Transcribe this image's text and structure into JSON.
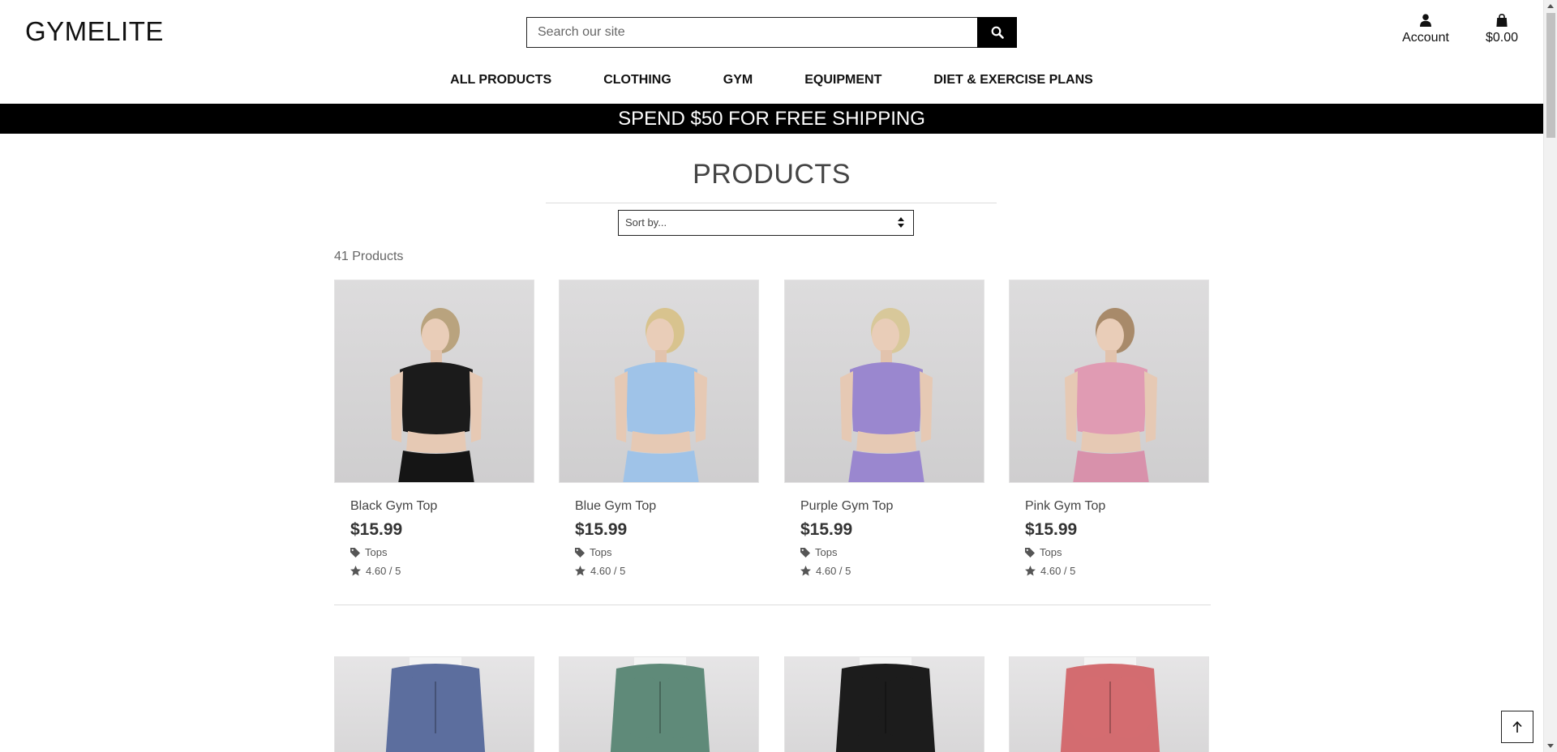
{
  "header": {
    "logo": "GYMELITE",
    "search_placeholder": "Search our site",
    "account_label": "Account",
    "cart_total": "$0.00"
  },
  "nav": {
    "items": [
      "ALL PRODUCTS",
      "CLOTHING",
      "GYM",
      "EQUIPMENT",
      "DIET & EXERCISE PLANS"
    ]
  },
  "banner": "SPEND $50 FOR FREE SHIPPING",
  "main": {
    "title": "PRODUCTS",
    "sort_label": "Sort by...",
    "count": "41 Products"
  },
  "products": [
    {
      "name": "Black Gym Top",
      "price": "$15.99",
      "category": "Tops",
      "rating": "4.60 / 5",
      "colors": {
        "top": "#1b1b1b",
        "bottom": "#151515",
        "hair": "#b9a37e"
      }
    },
    {
      "name": "Blue Gym Top",
      "price": "$15.99",
      "category": "Tops",
      "rating": "4.60 / 5",
      "colors": {
        "top": "#9fc3e8",
        "bottom": "#9fc3e8",
        "hair": "#d8c38e"
      }
    },
    {
      "name": "Purple Gym Top",
      "price": "$15.99",
      "category": "Tops",
      "rating": "4.60 / 5",
      "colors": {
        "top": "#9a87cf",
        "bottom": "#9a87cf",
        "hair": "#d8c89a"
      }
    },
    {
      "name": "Pink Gym Top",
      "price": "$15.99",
      "category": "Tops",
      "rating": "4.60 / 5",
      "colors": {
        "top": "#e09bb3",
        "bottom": "#d891ab",
        "hair": "#a88a6a"
      }
    }
  ],
  "row2_colors": [
    "#5c6e9e",
    "#5f8a79",
    "#1c1c1c",
    "#d36c70"
  ],
  "accent": "#000000"
}
